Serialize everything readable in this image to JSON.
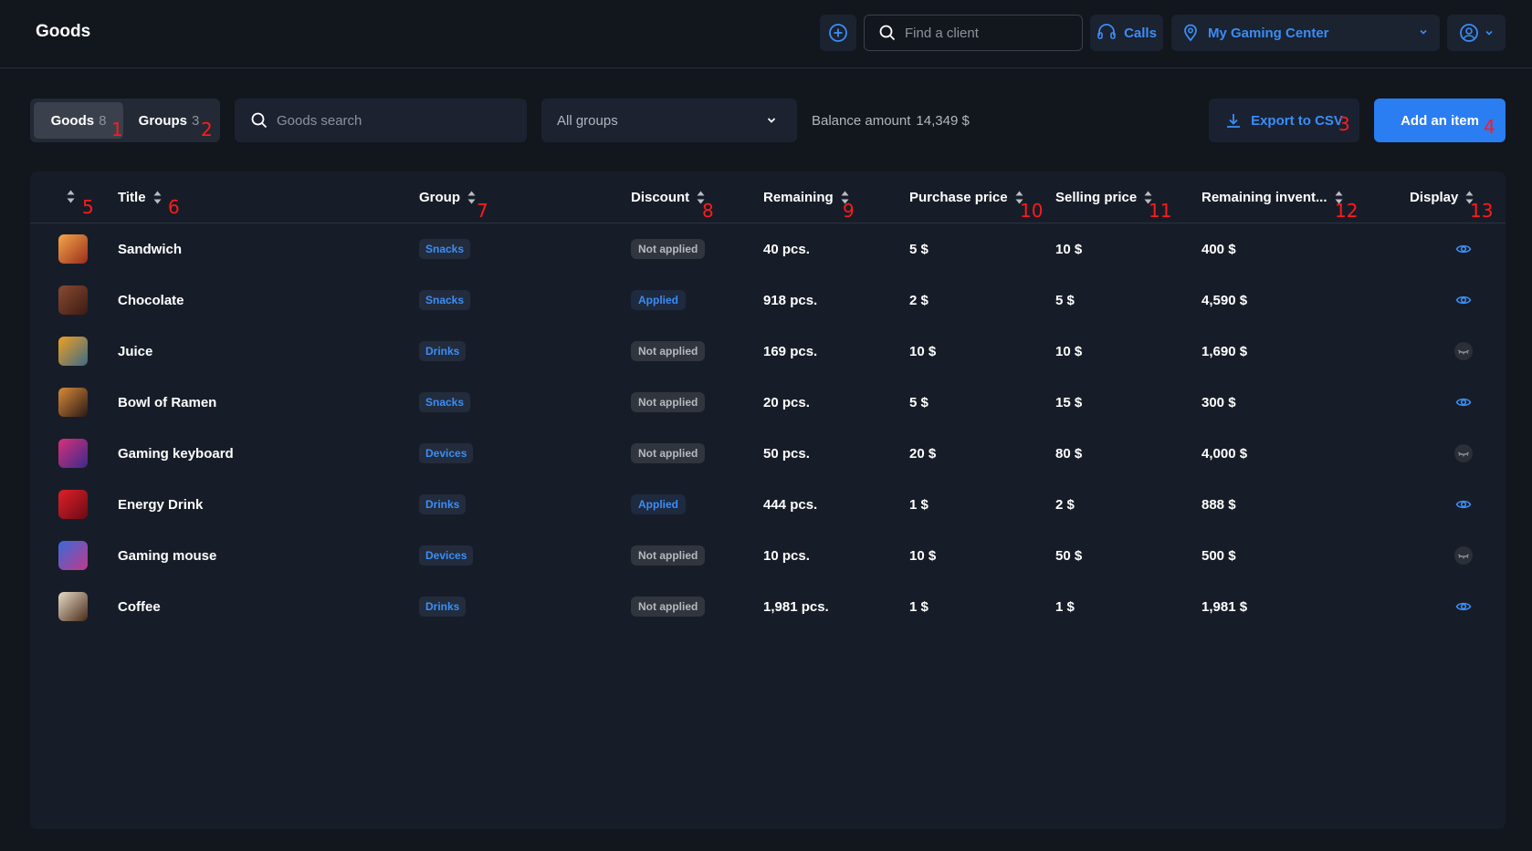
{
  "header": {
    "title": "Goods",
    "client_search_placeholder": "Find a client",
    "calls_label": "Calls",
    "center_label": "My Gaming Center"
  },
  "toolbar": {
    "tabs": [
      {
        "label": "Goods",
        "count": "8"
      },
      {
        "label": "Groups",
        "count": "3"
      }
    ],
    "goods_search_placeholder": "Goods search",
    "groups_select_value": "All groups",
    "balance_label": "Balance amount",
    "balance_amount": "14,349 $",
    "export_label": "Export to CSV",
    "add_label": "Add an item"
  },
  "table": {
    "columns": [
      "Title",
      "Group",
      "Discount",
      "Remaining",
      "Purchase price",
      "Selling price",
      "Remaining invent...",
      "Display"
    ],
    "rows": [
      {
        "title": "Sandwich",
        "group": "Snacks",
        "discount": "Not applied",
        "discount_applied": false,
        "remaining": "40 pcs.",
        "purchase": "5 $",
        "selling": "10 $",
        "inventory": "400 $",
        "visible": true,
        "thumb": [
          "#f4a74a",
          "#9a2c1c"
        ]
      },
      {
        "title": "Chocolate",
        "group": "Snacks",
        "discount": "Applied",
        "discount_applied": true,
        "remaining": "918 pcs.",
        "purchase": "2 $",
        "selling": "5 $",
        "inventory": "4,590 $",
        "visible": true,
        "thumb": [
          "#8a4a32",
          "#3b1b12"
        ]
      },
      {
        "title": "Juice",
        "group": "Drinks",
        "discount": "Not applied",
        "discount_applied": false,
        "remaining": "169 pcs.",
        "purchase": "10 $",
        "selling": "10 $",
        "inventory": "1,690 $",
        "visible": false,
        "thumb": [
          "#f0a020",
          "#3d6a8a"
        ]
      },
      {
        "title": "Bowl of Ramen",
        "group": "Snacks",
        "discount": "Not applied",
        "discount_applied": false,
        "remaining": "20 pcs.",
        "purchase": "5 $",
        "selling": "15 $",
        "inventory": "300 $",
        "visible": true,
        "thumb": [
          "#d98a3a",
          "#2a1a14"
        ]
      },
      {
        "title": "Gaming keyboard",
        "group": "Devices",
        "discount": "Not applied",
        "discount_applied": false,
        "remaining": "50 pcs.",
        "purchase": "20 $",
        "selling": "80 $",
        "inventory": "4,000 $",
        "visible": false,
        "thumb": [
          "#d8307a",
          "#3a2a8a"
        ]
      },
      {
        "title": "Energy Drink",
        "group": "Drinks",
        "discount": "Applied",
        "discount_applied": true,
        "remaining": "444 pcs.",
        "purchase": "1 $",
        "selling": "2 $",
        "inventory": "888 $",
        "visible": true,
        "thumb": [
          "#e0202a",
          "#6a0a14"
        ]
      },
      {
        "title": "Gaming mouse",
        "group": "Devices",
        "discount": "Not applied",
        "discount_applied": false,
        "remaining": "10 pcs.",
        "purchase": "10 $",
        "selling": "50 $",
        "inventory": "500 $",
        "visible": false,
        "thumb": [
          "#3a6ad8",
          "#c03a8a"
        ]
      },
      {
        "title": "Coffee",
        "group": "Drinks",
        "discount": "Not applied",
        "discount_applied": false,
        "remaining": "1,981 pcs.",
        "purchase": "1 $",
        "selling": "1 $",
        "inventory": "1,981 $",
        "visible": true,
        "thumb": [
          "#e8dcc8",
          "#4a2a18"
        ]
      }
    ]
  },
  "markers": [
    "1",
    "2",
    "3",
    "4",
    "5",
    "6",
    "7",
    "8",
    "9",
    "10",
    "11",
    "12",
    "13"
  ],
  "colors": {
    "accent": "#3b8df5",
    "primary_button": "#2b7df2",
    "background": "#12161d",
    "marker": "#ff1a1a"
  }
}
